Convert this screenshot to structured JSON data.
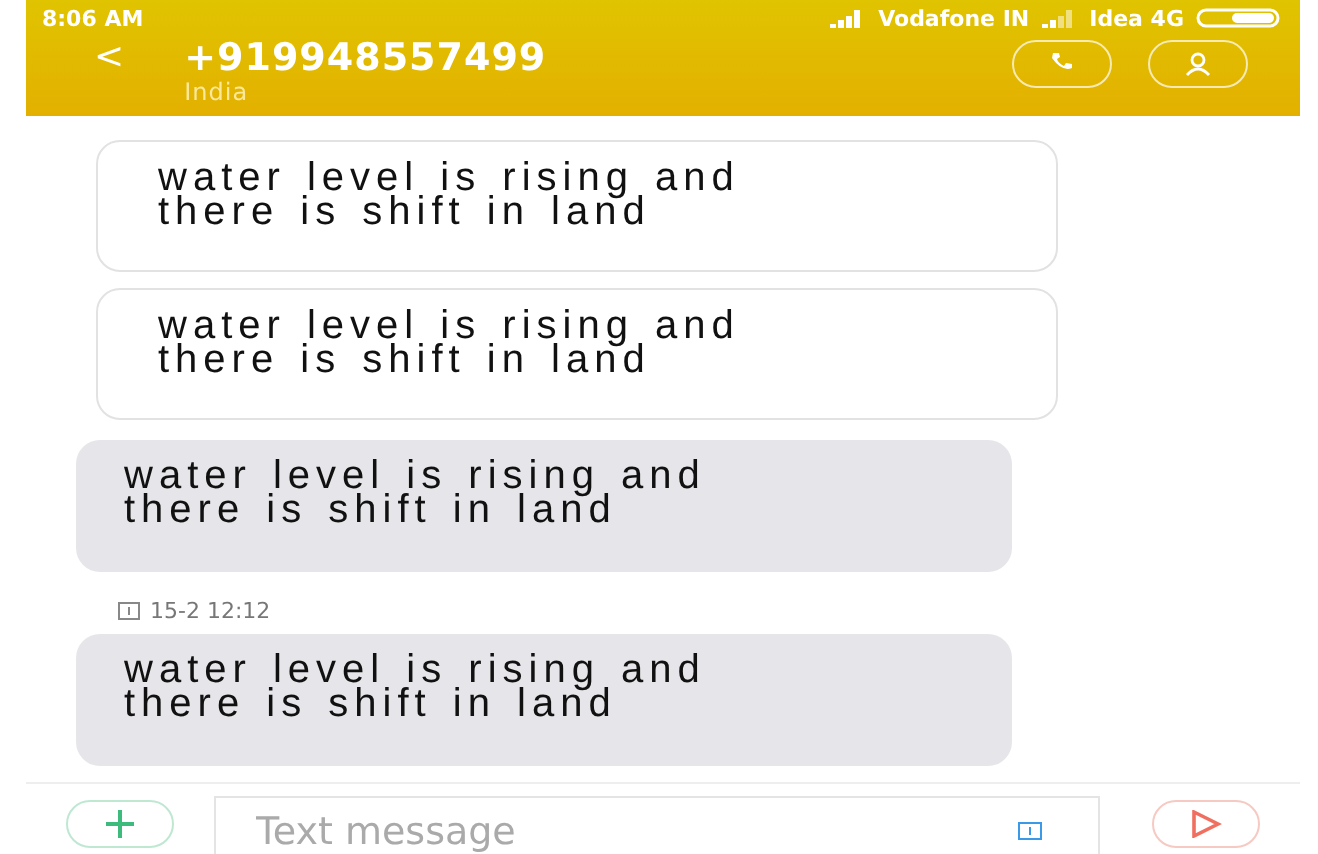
{
  "status_bar": {
    "time": "8:06 AM",
    "carrier_1": "Vodafone IN",
    "carrier_2": "Idea 4G"
  },
  "header": {
    "back": "<",
    "title": "+919948557499",
    "subtitle": "India"
  },
  "messages": [
    {
      "kind": "outline",
      "text": "water level is rising and there is shift in land"
    },
    {
      "kind": "outline",
      "text": "water level is rising and there is shift in land"
    },
    {
      "kind": "filled",
      "text": "water level is rising and there is shift in land"
    },
    {
      "kind": "timestamp",
      "text": "15-2 12:12"
    },
    {
      "kind": "filled",
      "text": "water level is rising and there is shift in land"
    }
  ],
  "composer": {
    "placeholder": "Text message"
  }
}
